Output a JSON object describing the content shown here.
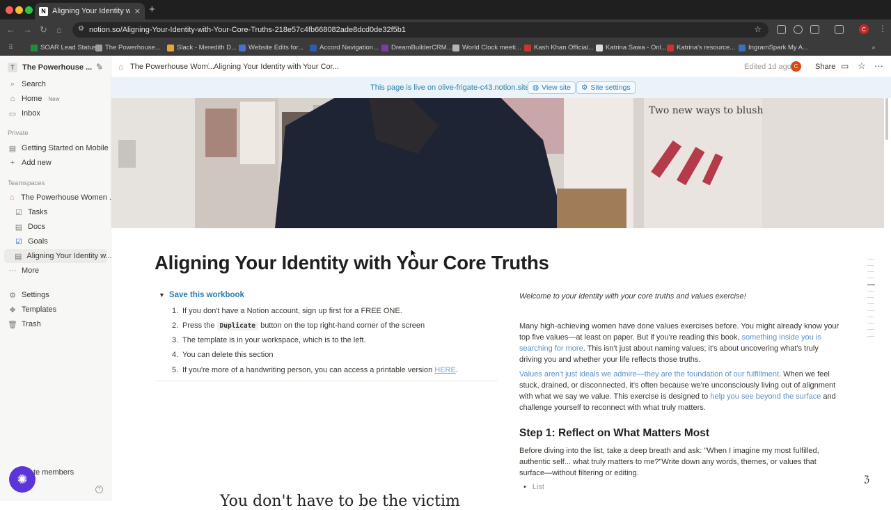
{
  "browser": {
    "tab_title": "Aligning Your Identity with Yo",
    "tab_favicon": "N",
    "url": "notion.so/Aligning-Your-Identity-with-Your-Core-Truths-218e57c4fb668082ade8dcd0de32f5b1",
    "profile_initial": "C",
    "bookmarks": [
      {
        "label": "SOAR Lead Status",
        "color": "#1e8e3e"
      },
      {
        "label": "The Powerhouse...",
        "color": "#9e9e9e"
      },
      {
        "label": "Slack - Meredith D...",
        "color": "#e8a33d"
      },
      {
        "label": "Website Edits for...",
        "color": "#4a6fd0"
      },
      {
        "label": "Accord Navigation...",
        "color": "#2d5ea8"
      },
      {
        "label": "DreamBuilderCRM...",
        "color": "#7b3fa3"
      },
      {
        "label": "World Clock meeti...",
        "color": "#b5b5b5"
      },
      {
        "label": "Kash Khan Official...",
        "color": "#c0392b"
      },
      {
        "label": "Katrina Sawa - Onl...",
        "color": "#dddddd"
      },
      {
        "label": "Katrina's resource...",
        "color": "#d32f2f"
      },
      {
        "label": "IngramSpark My A...",
        "color": "#3f6fb5"
      }
    ]
  },
  "sidebar": {
    "workspace_initial": "T",
    "workspace_name": "The Powerhouse ...",
    "search": "Search",
    "home": "Home",
    "home_badge": "New",
    "inbox": "Inbox",
    "private_label": "Private",
    "private_pages": [
      "Getting Started on Mobile"
    ],
    "add_new": "Add new",
    "teamspaces_label": "Teamspaces",
    "teamspace_name": "The Powerhouse Women ...",
    "team_pages": [
      "Tasks",
      "Docs",
      "Goals",
      "Aligning Your Identity w..."
    ],
    "more": "More",
    "settings": "Settings",
    "templates": "Templates",
    "trash": "Trash",
    "invite": "te members"
  },
  "topbar": {
    "crumb_parent": "The Powerhouse Wom...",
    "crumb_current": "Aligning Your Identity with Your Cor...",
    "edited": "Edited 1d ago",
    "avatar_initial": "C",
    "share": "Share"
  },
  "banner": {
    "text": "This page is live on olive-frigate-c43.notion.site",
    "view_site": "View site",
    "site_settings": "Site settings"
  },
  "cover": {
    "poster_text": "Two new ways to blush"
  },
  "page": {
    "title": "Aligning Your Identity with Your Core Truths",
    "toggle_label": "Save this workbook",
    "steps": [
      {
        "n": "1.",
        "text": "If you don't have a Notion account, sign up first for a FREE ONE."
      },
      {
        "n": "2.",
        "pre": "Press the ",
        "code": "Duplicate",
        "post": " button on the top right-hand corner of the screen"
      },
      {
        "n": "3.",
        "text": "The template is in your workspace, which is to the left."
      },
      {
        "n": "4.",
        "text": "You can delete this section"
      },
      {
        "n": "5.",
        "pre": "If you're more of a handwriting person, you can access a printable version ",
        "link": "HERE",
        "post": "."
      }
    ],
    "welcome": "Welcome to your identity with your core truths and values exercise!",
    "para1_a": "Many high-achieving women have done values exercises before. You might already know your top five values—at least on paper. But if you're reading this book, ",
    "para1_link": "something inside you is searching for more",
    "para1_b": ". This isn't just about naming values; it's about uncovering what's truly driving you and whether your life reflects those truths.",
    "para2_link": "Values aren't just ideals we admire—they are the foundation of our fulfillment",
    "para2_a": ". When we feel stuck, drained, or disconnected, it's often because we're unconsciously living out of alignment with what we say we value. This exercise is designed to ",
    "para2_link2": "help you see beyond the surface",
    "para2_b": " and challenge yourself to reconnect with what truly matters.",
    "step1_heading": "Step 1: Reflect on What Matters Most",
    "step1_text": "Before diving into the list, take a deep breath and ask: \"When I imagine my most fulfilled, authentic self... what truly matters to me?\"Write down any words, themes, or values that surface—without filtering or editing.",
    "bullet_placeholder": "List",
    "ghost_heading": "You don't have to be the victim"
  }
}
